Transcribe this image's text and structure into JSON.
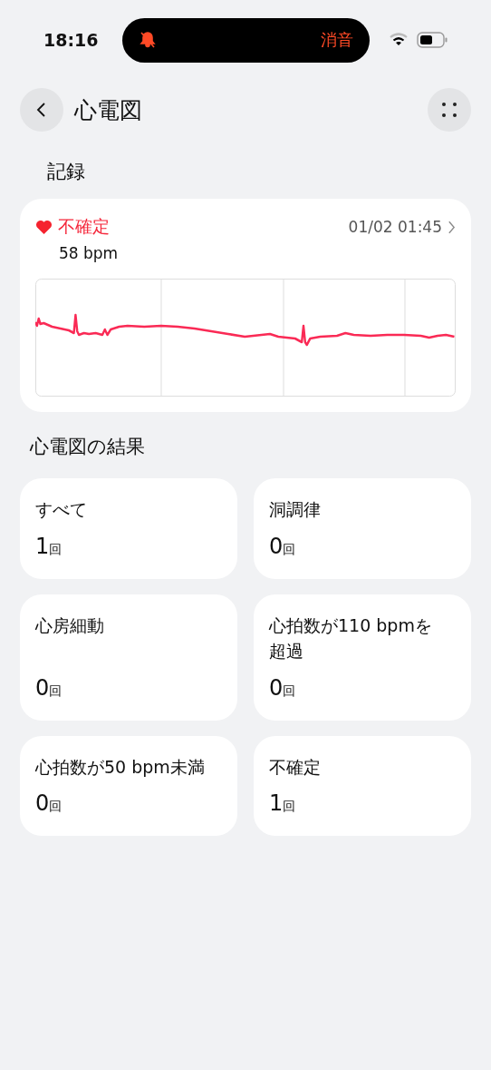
{
  "status_bar": {
    "time": "18:16",
    "island_label": "消音"
  },
  "header": {
    "title": "心電図"
  },
  "record_section": {
    "title": "記録",
    "record": {
      "status": "不確定",
      "heart_rate": "58 bpm",
      "timestamp": "01/02 01:45"
    }
  },
  "results_section": {
    "title": "心電図の結果",
    "items": [
      {
        "label": "すべて",
        "count": "1",
        "unit": "回"
      },
      {
        "label": "洞調律",
        "count": "0",
        "unit": "回"
      },
      {
        "label": "心房細動",
        "count": "0",
        "unit": "回"
      },
      {
        "label": "心拍数が110 bpmを超過",
        "count": "0",
        "unit": "回"
      },
      {
        "label": "心拍数が50 bpm未満",
        "count": "0",
        "unit": "回"
      },
      {
        "label": "不確定",
        "count": "1",
        "unit": "回"
      }
    ]
  }
}
